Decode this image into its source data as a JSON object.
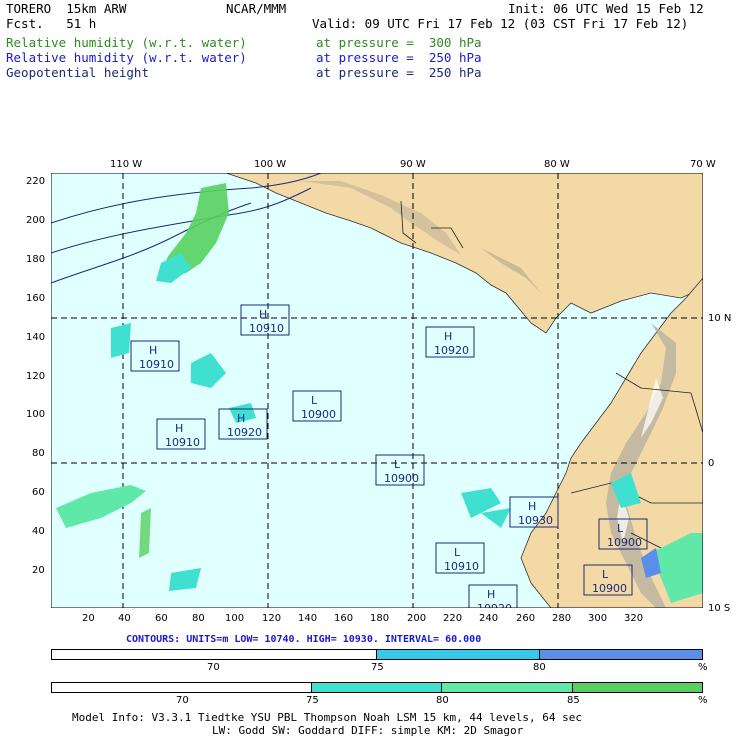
{
  "header": {
    "model": "TORERO  15km ARW",
    "org": "NCAR/MMM",
    "init": "Init: 06 UTC Wed 15 Feb 12",
    "fcst": "Fcst.   51 h",
    "valid": "Valid: 09 UTC Fri 17 Feb 12 (03 CST Fri 17 Feb 12)",
    "fields": [
      {
        "name": "Relative humidity (w.r.t. water)",
        "level": "at pressure =  300 hPa",
        "color": "#2e8b1f"
      },
      {
        "name": "Relative humidity (w.r.t. water)",
        "level": "at pressure =  250 hPa",
        "color": "#1a1acc"
      },
      {
        "name": "Geopotential height",
        "level": "at pressure =  250 hPa",
        "color": "#1a2a7a"
      }
    ]
  },
  "map": {
    "ocean_color": "#e0ffff",
    "land_color": "#f2d9a6",
    "lon_labels": [
      "110 W",
      "100 W",
      "90 W",
      "80 W",
      "70 W"
    ],
    "lat_labels": [
      "10 N",
      "0",
      "10 S"
    ],
    "x_ticks": [
      "20",
      "40",
      "60",
      "80",
      "100",
      "120",
      "140",
      "160",
      "180",
      "200",
      "220",
      "240",
      "260",
      "280",
      "300",
      "320"
    ],
    "y_ticks": [
      "220",
      "200",
      "180",
      "160",
      "140",
      "120",
      "100",
      "80",
      "60",
      "40",
      "20"
    ],
    "centers": [
      {
        "type": "H",
        "value": "10910"
      },
      {
        "type": "H",
        "value": "10910"
      },
      {
        "type": "H",
        "value": "10920"
      },
      {
        "type": "H",
        "value": "10910"
      },
      {
        "type": "H",
        "value": "10920"
      },
      {
        "type": "L",
        "value": "10900"
      },
      {
        "type": "L",
        "value": "10900"
      },
      {
        "type": "H",
        "value": "10930"
      },
      {
        "type": "L",
        "value": "10900"
      },
      {
        "type": "L",
        "value": "10910"
      },
      {
        "type": "H",
        "value": "10920"
      },
      {
        "type": "L",
        "value": "10900"
      }
    ]
  },
  "contours": "CONTOURS: UNITS=m  LOW= 10740.  HIGH= 10930.  INTERVAL= 60.000",
  "colorbar1": {
    "labels": [
      "70",
      "75",
      "80",
      "%"
    ],
    "colors": [
      "#ffffff",
      "#38c8e8",
      "#5a8ee8"
    ]
  },
  "colorbar2": {
    "labels": [
      "70",
      "75",
      "80",
      "85",
      "%"
    ],
    "colors": [
      "#ffffff",
      "#40e0d0",
      "#60e8a8",
      "#58d060"
    ]
  },
  "footer": {
    "line1": "Model Info: V3.3.1   Tiedtke YSU PBL  Thompson   Noah LSM  15 km,   44 levels,   64 sec",
    "line2": "LW: Godd SW: Goddard DIFF: simple KM: 2D Smagor"
  }
}
